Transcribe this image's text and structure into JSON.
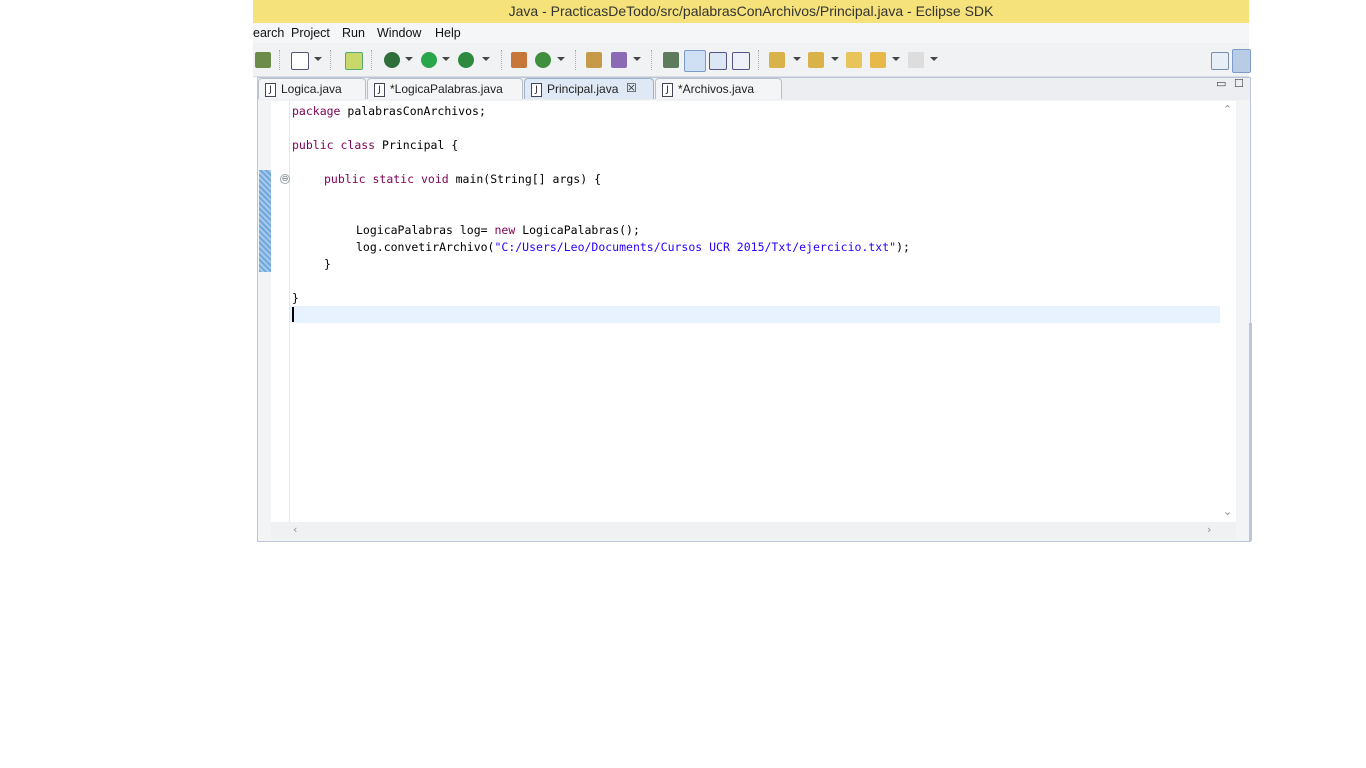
{
  "window": {
    "title": "Java - PracticasDeTodo/src/palabrasConArchivos/Principal.java - Eclipse SDK"
  },
  "menu": [
    "earch",
    "Project",
    "Run",
    "Window",
    "Help"
  ],
  "tabs": [
    {
      "label": "Logica.java",
      "active": false,
      "dirty": false
    },
    {
      "label": "*LogicaPalabras.java",
      "active": false,
      "dirty": true
    },
    {
      "label": "Principal.java",
      "active": true,
      "dirty": false,
      "close": "☒"
    },
    {
      "label": "*Archivos.java",
      "active": false,
      "dirty": true
    }
  ],
  "code": {
    "line1": {
      "kw": "package",
      "rest": " palabrasConArchivos;"
    },
    "line3": {
      "kw1": "public",
      "kw2": "class",
      "rest": " Principal {"
    },
    "line5": {
      "kw1": "public",
      "kw2": "static",
      "kw3": "void",
      "rest": " main(String[] args) {"
    },
    "line8": {
      "pre": "LogicaPalabras log= ",
      "kw": "new",
      "post": " LogicaPalabras();"
    },
    "line9": {
      "pre": "log.convetirArchivo(",
      "str": "\"C:/Users/Leo/Documents/Cursos UCR 2015/Txt/ejercicio.txt\"",
      "post": ");"
    },
    "line10": "}",
    "line12": "}"
  },
  "fold_marker": "⊖",
  "view_controls": {
    "minimize": "▭",
    "maximize": "☐"
  },
  "toolbar_icons": [
    "save-icon",
    "checkbox-icon",
    "new-class-icon",
    "debug-icon",
    "run-icon",
    "external-tools-icon",
    "new-package-icon",
    "refresh-icon",
    "open-type-icon",
    "open-task-icon",
    "link-icon",
    "highlight-icon",
    "block-selection-icon",
    "show-whitespace-icon",
    "next-annotation-icon",
    "prev-annotation-icon",
    "last-edit-icon",
    "back-icon",
    "forward-icon",
    "open-perspective-icon",
    "java-perspective-icon"
  ],
  "colors": {
    "titlebar": "#f6e27a",
    "keyword": "#7f0055",
    "string": "#2a00ff",
    "current_line": "#e8f2fe"
  }
}
